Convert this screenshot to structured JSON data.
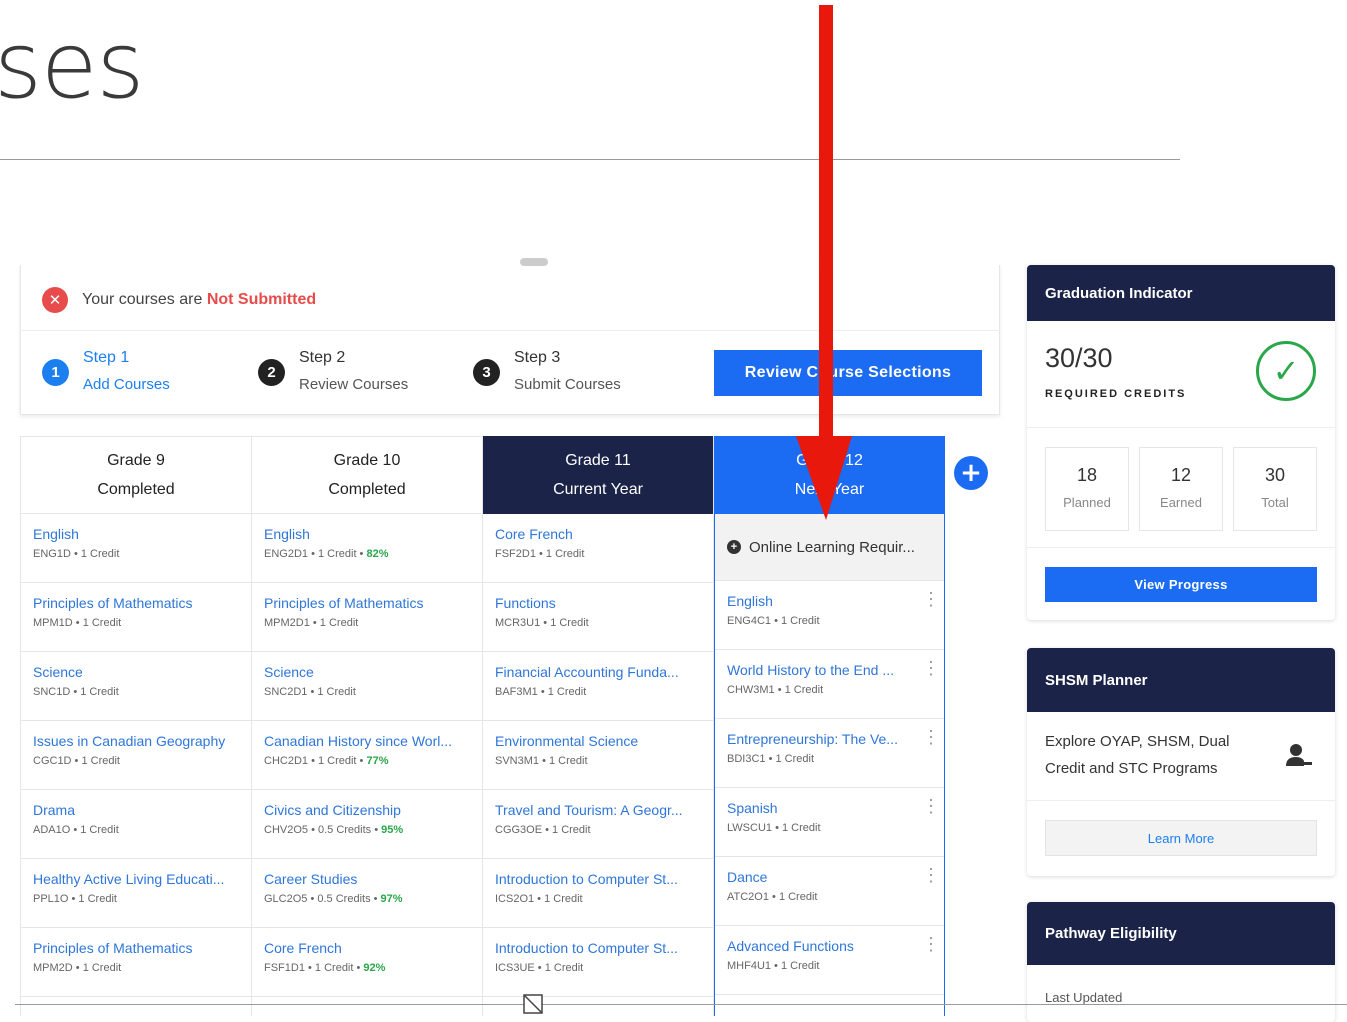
{
  "page": {
    "title_fragment": "ses"
  },
  "status": {
    "prefix": "Your courses are ",
    "state": "Not Submitted"
  },
  "steps": [
    {
      "num": "1",
      "title": "Step 1",
      "sub": "Add Courses"
    },
    {
      "num": "2",
      "title": "Step 2",
      "sub": "Review Courses"
    },
    {
      "num": "3",
      "title": "Step 3",
      "sub": "Submit Courses"
    }
  ],
  "review_button": "Review Course Selections",
  "grades": [
    {
      "title": "Grade 9",
      "status": "Completed",
      "courses": [
        {
          "name": "English",
          "code": "ENG1D • 1 Credit",
          "pct": ""
        },
        {
          "name": "Principles of Mathematics",
          "code": "MPM1D • 1 Credit",
          "pct": ""
        },
        {
          "name": "Science",
          "code": "SNC1D • 1 Credit",
          "pct": ""
        },
        {
          "name": "Issues in Canadian Geography",
          "code": "CGC1D • 1 Credit",
          "pct": ""
        },
        {
          "name": "Drama",
          "code": "ADA1O • 1 Credit",
          "pct": ""
        },
        {
          "name": "Healthy Active Living Educati...",
          "code": "PPL1O • 1 Credit",
          "pct": ""
        },
        {
          "name": "Principles of Mathematics",
          "code": "MPM2D • 1 Credit",
          "pct": ""
        }
      ]
    },
    {
      "title": "Grade 10",
      "status": "Completed",
      "courses": [
        {
          "name": "English",
          "code": "ENG2D1 • 1 Credit • ",
          "pct": "82%"
        },
        {
          "name": "Principles of Mathematics",
          "code": "MPM2D1 • 1 Credit",
          "pct": ""
        },
        {
          "name": "Science",
          "code": "SNC2D1 • 1 Credit",
          "pct": ""
        },
        {
          "name": "Canadian History since Worl...",
          "code": "CHC2D1 • 1 Credit • ",
          "pct": "77%"
        },
        {
          "name": "Civics and Citizenship",
          "code": "CHV2O5 • 0.5 Credits • ",
          "pct": "95%"
        },
        {
          "name": "Career Studies",
          "code": "GLC2O5 • 0.5 Credits • ",
          "pct": "97%"
        },
        {
          "name": "Core French",
          "code": "FSF1D1 • 1 Credit • ",
          "pct": "92%"
        }
      ]
    },
    {
      "title": "Grade 11",
      "status": "Current Year",
      "courses": [
        {
          "name": "Core French",
          "code": "FSF2D1 • 1 Credit",
          "pct": ""
        },
        {
          "name": "Functions",
          "code": "MCR3U1 • 1 Credit",
          "pct": ""
        },
        {
          "name": "Financial Accounting Funda...",
          "code": "BAF3M1 • 1 Credit",
          "pct": ""
        },
        {
          "name": "Environmental Science",
          "code": "SVN3M1 • 1 Credit",
          "pct": ""
        },
        {
          "name": "Travel and Tourism: A Geogr...",
          "code": "CGG3OE • 1 Credit",
          "pct": ""
        },
        {
          "name": "Introduction to Computer St...",
          "code": "ICS2O1 • 1 Credit",
          "pct": ""
        },
        {
          "name": "Introduction to Computer St...",
          "code": "ICS3UE • 1 Credit",
          "pct": ""
        }
      ]
    },
    {
      "title": "Grade 12",
      "status": "Next Year",
      "online": "Online Learning Requir...",
      "courses": [
        {
          "name": "English",
          "code": "ENG4C1 • 1 Credit",
          "pct": ""
        },
        {
          "name": "World History to the End ...",
          "code": "CHW3M1 • 1 Credit",
          "pct": ""
        },
        {
          "name": "Entrepreneurship: The Ve...",
          "code": "BDI3C1 • 1 Credit",
          "pct": ""
        },
        {
          "name": "Spanish",
          "code": "LWSCU1 • 1 Credit",
          "pct": ""
        },
        {
          "name": "Dance",
          "code": "ATC2O1 • 1 Credit",
          "pct": ""
        },
        {
          "name": "Advanced Functions",
          "code": "MHF4U1 • 1 Credit",
          "pct": ""
        }
      ]
    }
  ],
  "graduation": {
    "title": "Graduation Indicator",
    "credits": "30/30",
    "credits_label": "REQUIRED CREDITS",
    "stats": [
      {
        "n": "18",
        "l": "Planned"
      },
      {
        "n": "12",
        "l": "Earned"
      },
      {
        "n": "30",
        "l": "Total"
      }
    ],
    "button": "View Progress"
  },
  "shsm": {
    "title": "SHSM Planner",
    "text": "Explore OYAP, SHSM, Dual Credit and STC Programs",
    "button": "Learn More"
  },
  "pathway": {
    "title": "Pathway Eligibility",
    "last_updated": "Last Updated"
  },
  "colors": {
    "accent": "#1b6cf2",
    "navy": "#1b2348",
    "error": "#e84b4b",
    "success": "#2aa74a",
    "annotation_arrow": "#e8180c"
  }
}
